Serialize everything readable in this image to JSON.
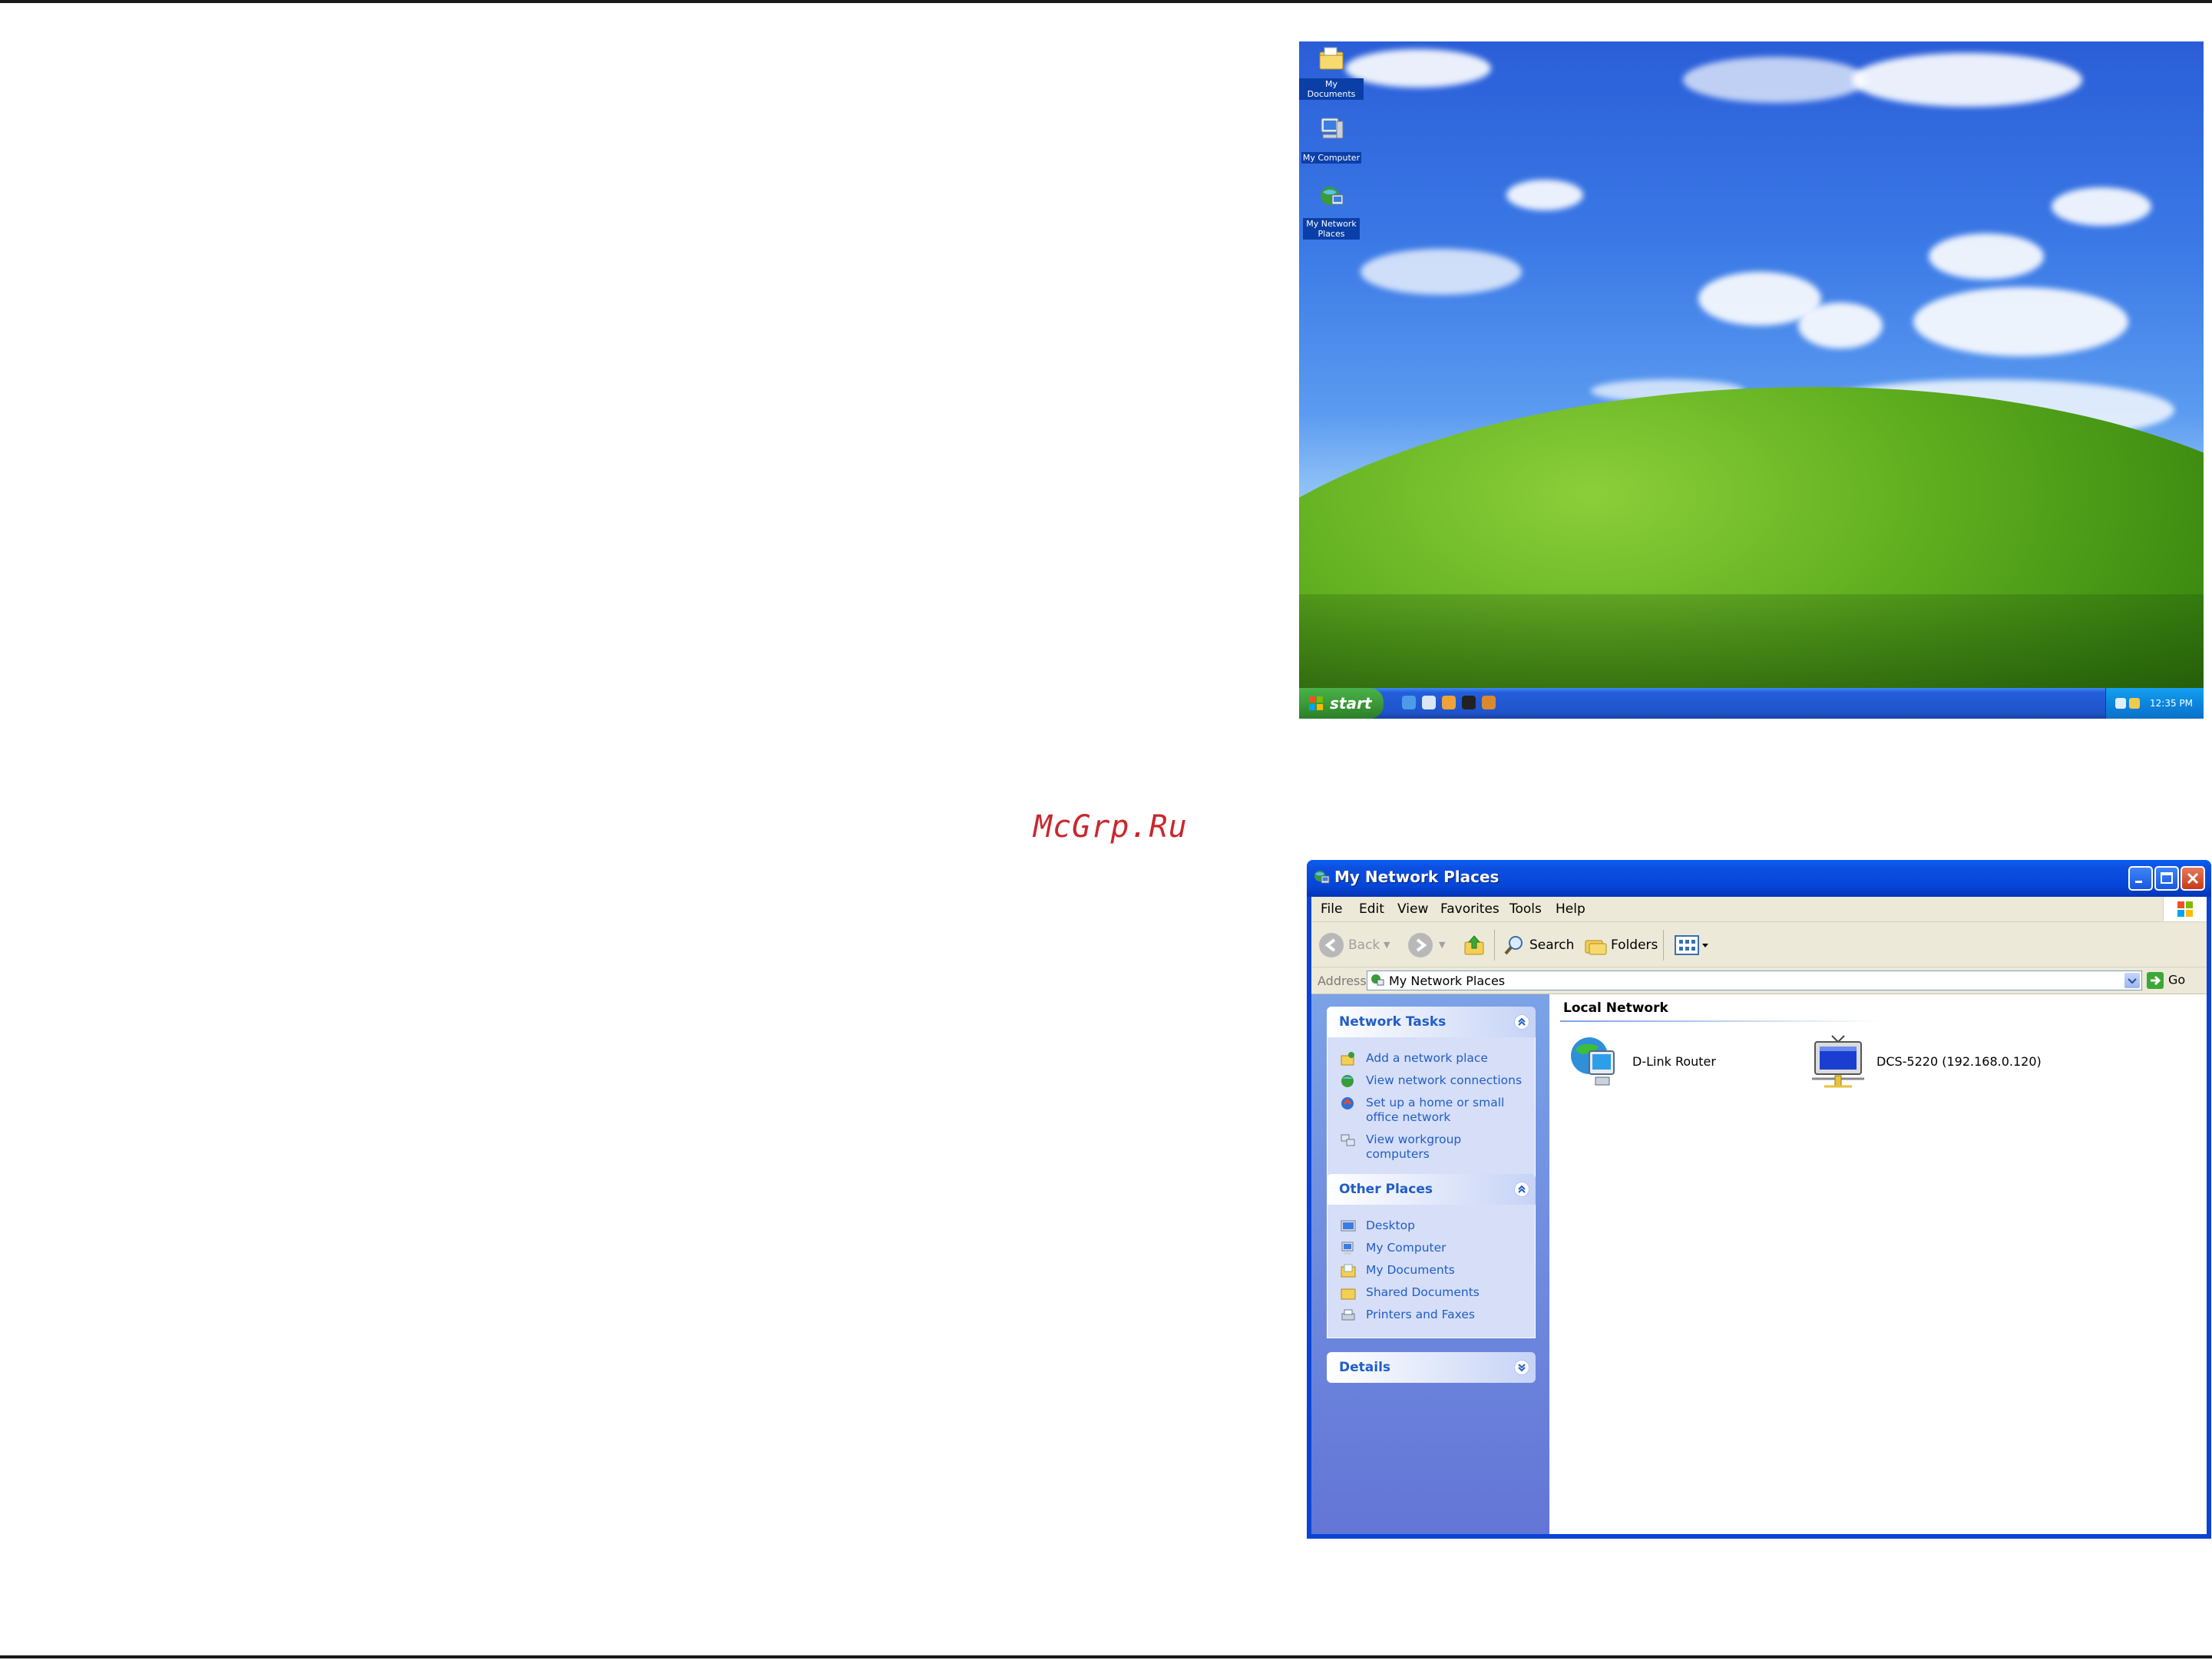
{
  "watermark": "McGrp.Ru",
  "desktop": {
    "icons": [
      {
        "label": "My Documents"
      },
      {
        "label": "My Computer"
      },
      {
        "label": "My Network Places"
      }
    ],
    "taskbar": {
      "start_label": "start",
      "clock": "12:35 PM"
    }
  },
  "explorer": {
    "title": "My Network Places",
    "menu": [
      "File",
      "Edit",
      "View",
      "Favorites",
      "Tools",
      "Help"
    ],
    "toolbar": {
      "back": "Back",
      "search": "Search",
      "folders": "Folders"
    },
    "address": {
      "label": "Address",
      "value": "My Network Places",
      "go": "Go"
    },
    "network_tasks": {
      "title": "Network Tasks",
      "items": [
        "Add a network place",
        "View network connections",
        "Set up a home or small office network",
        "View workgroup computers"
      ]
    },
    "other_places": {
      "title": "Other Places",
      "items": [
        "Desktop",
        "My Computer",
        "My Documents",
        "Shared Documents",
        "Printers and Faxes"
      ]
    },
    "details": {
      "title": "Details"
    },
    "group": {
      "title": "Local Network",
      "items": [
        {
          "name": "D-Link Router"
        },
        {
          "name": "DCS-5220 (192.168.0.120)"
        }
      ]
    }
  }
}
